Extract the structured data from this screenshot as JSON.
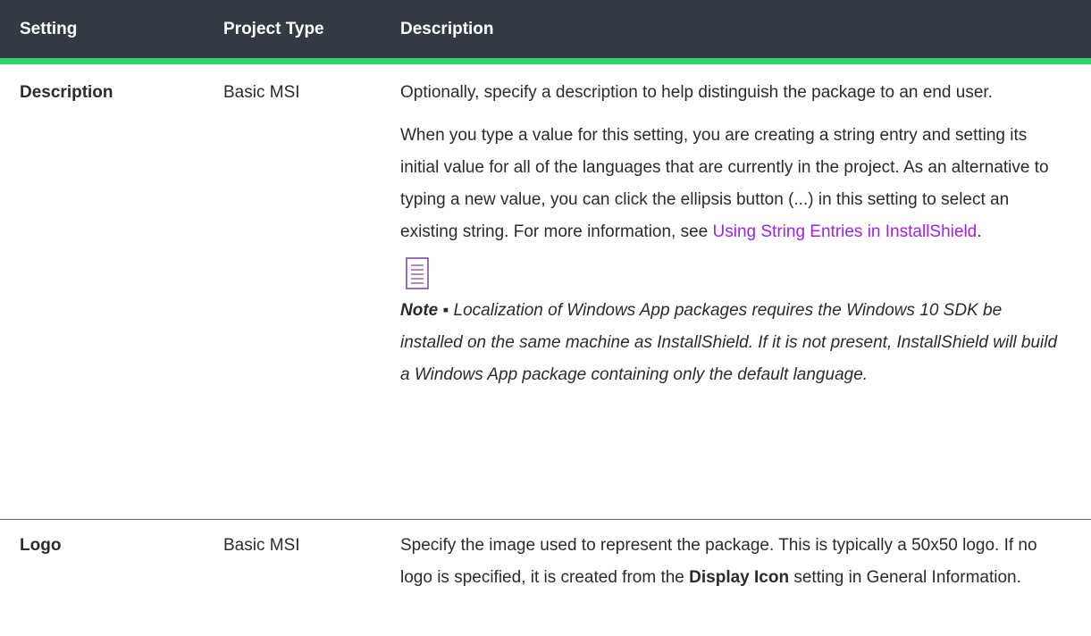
{
  "header": {
    "setting": "Setting",
    "project_type": "Project Type",
    "description": "Description"
  },
  "rows": [
    {
      "setting": "Description",
      "project_type": "Basic MSI",
      "para1": "Optionally, specify a description to help distinguish the package to an end user.",
      "para2_before_link": "When you type a value for this setting, you are creating a string entry and setting its initial value for all of the languages that are currently in the project. As an alternative to typing a new value, you can click the ellipsis button (...) in this setting to select an existing string. For more information, see ",
      "para2_link": "Using String Entries in InstallShield",
      "para2_after_link": ".",
      "note_icon": "note-icon",
      "note_label": "Note",
      "note_sep": " ▪ ",
      "note_text": "Localization of Windows App packages requires the Windows 10 SDK be installed on the same machine as InstallShield. If it is not present, InstallShield will build a Windows App package containing only the default language."
    },
    {
      "setting": "Logo",
      "project_type": "Basic MSI",
      "desc_before_bold": "Specify the image used to represent the package. This is typically a 50x50 logo. If no logo is specified, it is created from the ",
      "desc_bold": "Display Icon",
      "desc_after_bold": " setting in General Information."
    }
  ],
  "colors": {
    "header_bg": "#323b44",
    "header_accent": "#2bd36a",
    "link": "#a020f0"
  }
}
